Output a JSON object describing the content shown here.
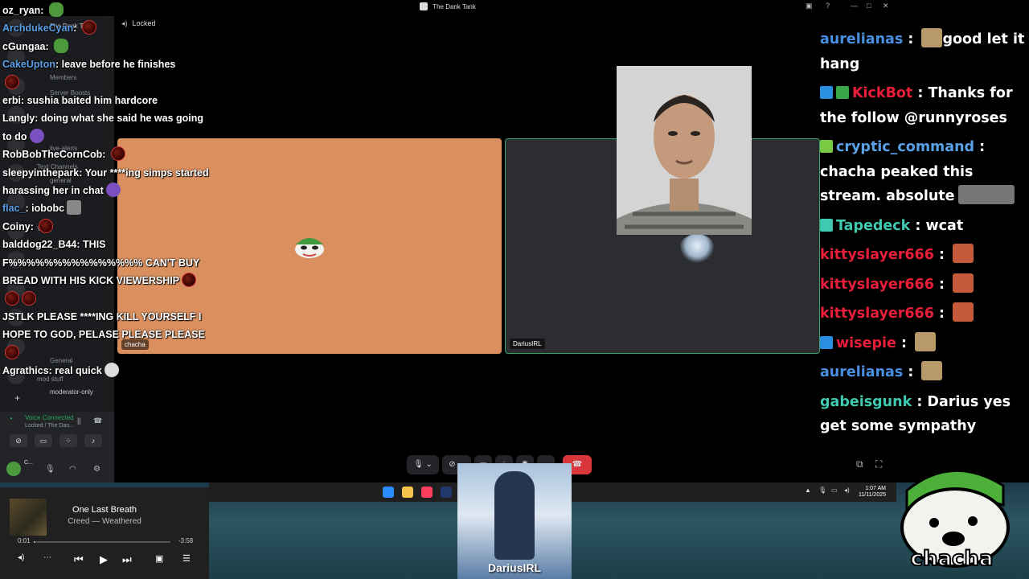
{
  "window": {
    "title": "The Dank Tank",
    "channel_status": "Locked"
  },
  "sidebar": {
    "server_name": "The Dank T...",
    "items": [
      "Members",
      "Server Boosts",
      "live-alerts",
      "Text Channels",
      "general",
      "VCs",
      "General",
      "mod stuff",
      "moderator-only"
    ],
    "voice": {
      "status": "Voice Connected",
      "location": "Locked / The Dan..."
    },
    "user_short": "C..."
  },
  "tiles": [
    {
      "name": "chacha",
      "bg": "#d98f5e"
    },
    {
      "name": "DariusIRL",
      "bg": "#2b2d31"
    }
  ],
  "chat_left": [
    {
      "user": "oz_ryan",
      "color": "#ffffff",
      "text": "",
      "emotes": [
        "pepe"
      ]
    },
    {
      "user": "ArchdukeCyan",
      "color": "#5aa0e6",
      "text": "",
      "emotes": [
        "red"
      ]
    },
    {
      "user": "cGungaa",
      "color": "#ffffff",
      "text": "",
      "emotes": [
        "pepe"
      ]
    },
    {
      "user": "CakeUpton",
      "color": "#5aa0e6",
      "text": "leave before he finishes",
      "emotes": []
    },
    {
      "user": "",
      "color": "#ffffff",
      "text": "",
      "emotes": [
        "red"
      ]
    },
    {
      "user": "erbi",
      "color": "#ffffff",
      "text": "sushia baited him hardcore",
      "emotes": []
    },
    {
      "user": "Langly",
      "color": "#ffffff",
      "text": "doing what she said he was going to do",
      "emotes": [
        "purple"
      ]
    },
    {
      "user": "RobBobTheCornCob",
      "color": "#ffffff",
      "text": "",
      "emotes": [
        "red"
      ]
    },
    {
      "user": "sleepyinthepark",
      "color": "#ffffff",
      "text": "Your ****ing simps started harassing her in chat",
      "emotes": [
        "purple"
      ]
    },
    {
      "user": "flac_",
      "color": "#5aa0e6",
      "text": "iobobc",
      "emotes": [
        "gray"
      ]
    },
    {
      "user": "Coiny",
      "color": "#ffffff",
      "text": "",
      "emotes": [
        "red"
      ]
    },
    {
      "user": "balddog22_B44",
      "color": "#ffffff",
      "text": "THIS F%%%%%%%%%%%%%%% CAN'T BUY BREAD WITH HIS KICK VIEWERSHIP",
      "emotes": [
        "red",
        "red",
        "red"
      ]
    },
    {
      "user": "",
      "color": "#ffffff",
      "text": "JSTLK PLEASE ****ING KILL YOURSELF I HOPE TO GOD, PELASE PLEASE PLEASE",
      "emotes": [
        "red"
      ]
    },
    {
      "user": "Agrathics",
      "color": "#ffffff",
      "text": "real quick",
      "emotes": [
        "white"
      ]
    }
  ],
  "chat_right": [
    {
      "badges": [],
      "user": "aurelianas",
      "color": "#4a90e2",
      "text": "good let it hang",
      "emote": "cat"
    },
    {
      "badges": [
        "kick",
        "verified"
      ],
      "user": "KickBot",
      "color": "#e91e3a",
      "text": "Thanks for the follow @runnyroses",
      "emote": ""
    },
    {
      "badges": [
        "diamond"
      ],
      "user": "cryptic_command",
      "color": "#5aa0e6",
      "text": "chacha peaked this stream. absolute",
      "emote": "face"
    },
    {
      "badges": [
        "grid"
      ],
      "user": "Tapedeck",
      "color": "#3ec9b0",
      "text": "wcat",
      "emote": ""
    },
    {
      "badges": [],
      "user": "kittyslayer666",
      "color": "#e91e3a",
      "text": "",
      "emote": "orange"
    },
    {
      "badges": [],
      "user": "kittyslayer666",
      "color": "#e91e3a",
      "text": "",
      "emote": "orange"
    },
    {
      "badges": [],
      "user": "kittyslayer666",
      "color": "#e91e3a",
      "text": "",
      "emote": "orange"
    },
    {
      "badges": [
        "kick"
      ],
      "user": "wisepie",
      "color": "#e91e3a",
      "text": "",
      "emote": "cat"
    },
    {
      "badges": [],
      "user": "aurelianas",
      "color": "#4a90e2",
      "text": "",
      "emote": "cat"
    },
    {
      "badges": [],
      "user": "gabeisgunk",
      "color": "#3ec9b0",
      "text": "Darius yes get some sympathy",
      "emote": ""
    }
  ],
  "music": {
    "song": "One Last Breath",
    "artist": "Creed — Weathered",
    "elapsed": "0:01",
    "remaining": "-3:58",
    "progress": 0.004
  },
  "clock": {
    "time": "1:07 AM",
    "date": "11/11/2025"
  },
  "cams": {
    "darius_label": "DariusIRL",
    "logo_label": "chacha"
  }
}
